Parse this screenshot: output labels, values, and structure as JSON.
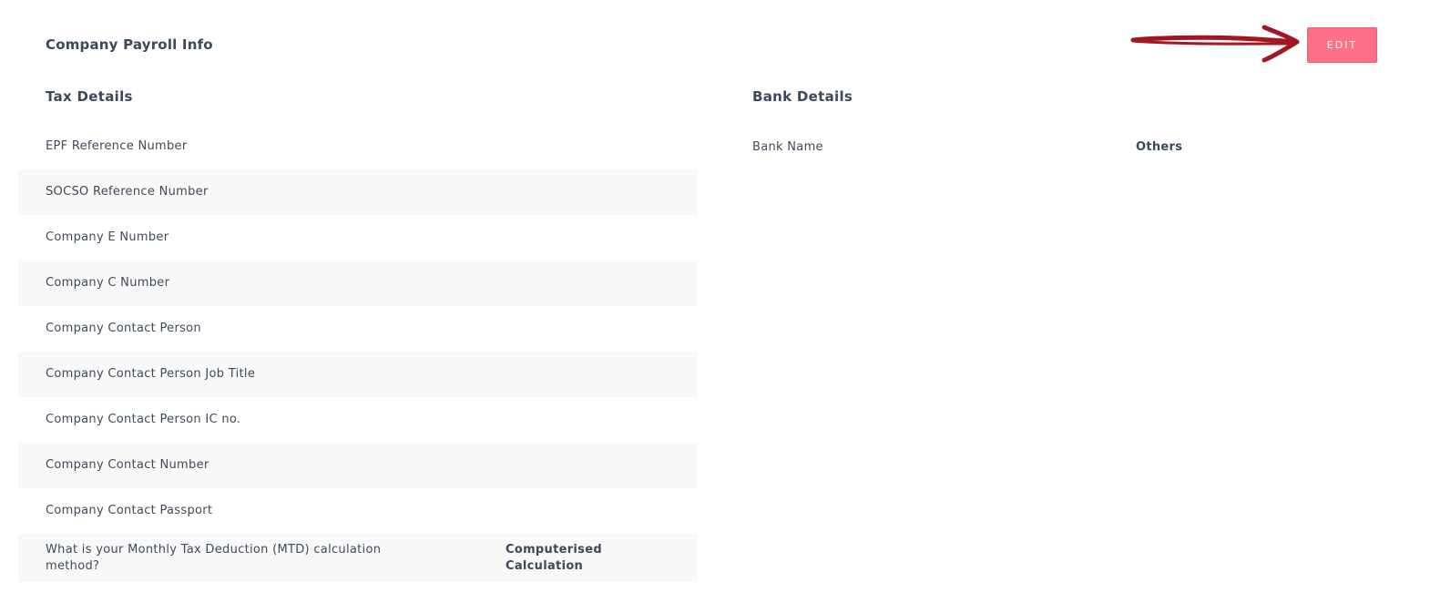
{
  "page": {
    "title": "Company Payroll Info",
    "edit_label": "EDIT",
    "accent_color": "#ff6f85",
    "annotation_color": "#a31720"
  },
  "tax": {
    "title": "Tax Details",
    "rows": [
      {
        "label": "EPF Reference Number",
        "value": ""
      },
      {
        "label": "SOCSO Reference Number",
        "value": ""
      },
      {
        "label": "Company E Number",
        "value": ""
      },
      {
        "label": "Company C Number",
        "value": ""
      },
      {
        "label": "Company Contact Person",
        "value": ""
      },
      {
        "label": "Company Contact Person Job Title",
        "value": ""
      },
      {
        "label": "Company Contact Person IC no.",
        "value": ""
      },
      {
        "label": "Company Contact Number",
        "value": ""
      },
      {
        "label": "Company Contact Passport",
        "value": ""
      },
      {
        "label": "What is your Monthly Tax Deduction (MTD) calculation method?",
        "value": "Computerised Calculation"
      }
    ]
  },
  "bank": {
    "title": "Bank Details",
    "rows": [
      {
        "label": "Bank Name",
        "value": "Others"
      }
    ]
  }
}
